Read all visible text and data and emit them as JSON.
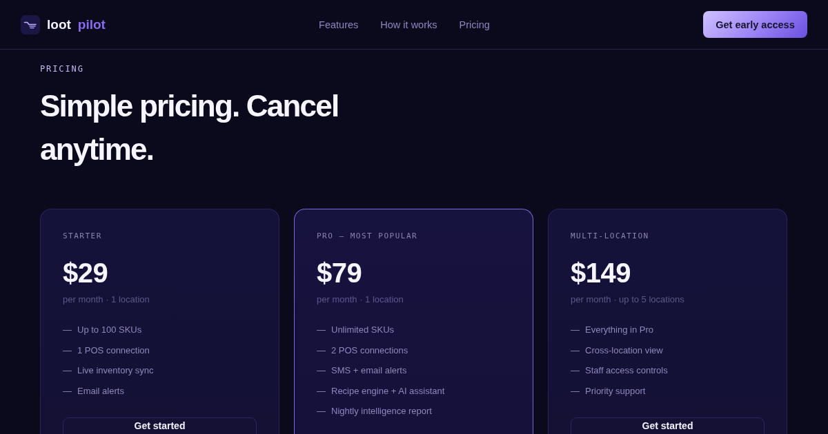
{
  "logo": {
    "text": "loot",
    "accent_text": "pilot"
  },
  "nav": {
    "links": [
      "Features",
      "How it works",
      "Pricing"
    ],
    "cta": "Get early access"
  },
  "section": {
    "eyebrow": "PRICING",
    "heading": "Simple pricing. Cancel anytime."
  },
  "plans": [
    {
      "label": "STARTER",
      "price": "$29",
      "note": "per month · 1 location",
      "highlighted": false,
      "features": [
        {
          "marker": "—",
          "text": "Up to 100 SKUs"
        },
        {
          "marker": "—",
          "text": "1 POS connection"
        },
        {
          "marker": "—",
          "text": "Live inventory sync"
        },
        {
          "marker": "—",
          "text": "Email alerts"
        }
      ],
      "button": "Get started"
    },
    {
      "label": "PRO — MOST POPULAR",
      "price": "$79",
      "note": "per month · 1 location",
      "highlighted": true,
      "features": [
        {
          "marker": "—",
          "text": "Unlimited SKUs"
        },
        {
          "marker": "—",
          "text": "2 POS connections"
        },
        {
          "marker": "—",
          "text": "SMS + email alerts"
        },
        {
          "marker": "—",
          "text": "Recipe engine + AI assistant"
        },
        {
          "marker": "—",
          "text": "Nightly intelligence report"
        }
      ]
    },
    {
      "label": "MULTI-LOCATION",
      "price": "$149",
      "note": "per month · up to 5 locations",
      "highlighted": false,
      "features": [
        {
          "marker": "—",
          "text": "Everything in Pro"
        },
        {
          "marker": "—",
          "text": "Cross-location view"
        },
        {
          "marker": "—",
          "text": "Staff access controls"
        },
        {
          "marker": "—",
          "text": "Priority support"
        }
      ],
      "button": "Get started"
    }
  ]
}
